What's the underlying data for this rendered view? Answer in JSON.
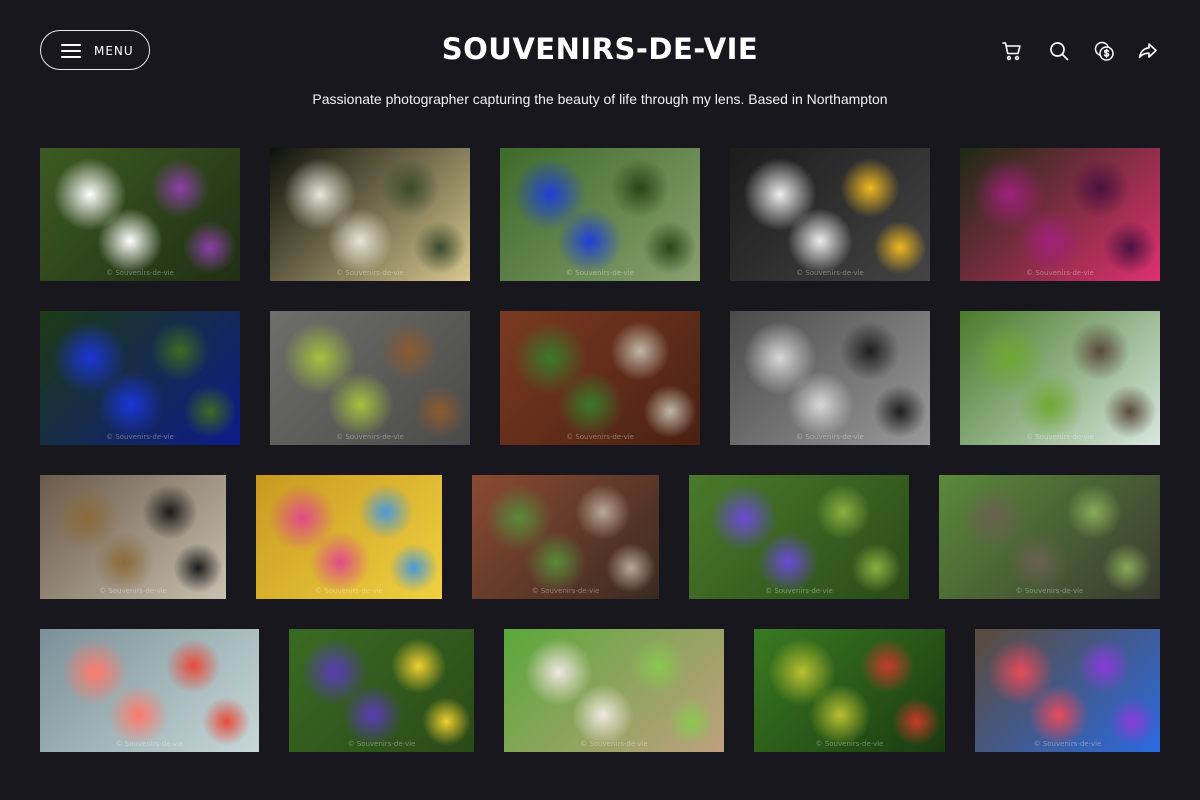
{
  "header": {
    "menu_label": "MENU",
    "title": "SOUVENIRS-DE-VIE",
    "tagline": "Passionate photographer capturing the beauty of life through my lens. Based in Northampton",
    "icons": [
      "cart-icon",
      "search-icon",
      "currency-icon",
      "share-icon"
    ]
  },
  "gallery": {
    "watermark": "© Souvenirs-de-vie",
    "photos": [
      {
        "name": "photo-white-purple-wildflowers",
        "colors": [
          "#3d5a22",
          "#ffffff",
          "#8b3fa6",
          "#1f2f14"
        ]
      },
      {
        "name": "photo-white-blossoms-dark",
        "colors": [
          "#0e120b",
          "#e8e6da",
          "#3a4a2a",
          "#d8c890"
        ]
      },
      {
        "name": "photo-blue-cornflowers-field",
        "colors": [
          "#3c6a2a",
          "#1f3fd6",
          "#2a4518",
          "#8aa070"
        ]
      },
      {
        "name": "photo-white-peony",
        "colors": [
          "#1c1c1c",
          "#eeeeee",
          "#f0b820",
          "#444444"
        ]
      },
      {
        "name": "photo-magenta-sweet-peas",
        "colors": [
          "#1d2a14",
          "#a0207a",
          "#4a1240",
          "#e03070"
        ]
      },
      {
        "name": "photo-blue-cornflowers-close",
        "colors": [
          "#1d3a14",
          "#1a35d8",
          "#3b6a22",
          "#0d1b8a"
        ]
      },
      {
        "name": "photo-leaves-on-cobblestones",
        "colors": [
          "#6e6e6a",
          "#a8c040",
          "#8c5a30",
          "#4a4a48"
        ]
      },
      {
        "name": "photo-bicycle-storefront",
        "colors": [
          "#7a3a22",
          "#3a7a2a",
          "#c0b8a8",
          "#4a2012"
        ]
      },
      {
        "name": "photo-bw-gears",
        "colors": [
          "#4a4a4a",
          "#d8d8d8",
          "#1e1e1e",
          "#9a9a9a"
        ]
      },
      {
        "name": "photo-thatched-cottage-garden",
        "colors": [
          "#4a7a2a",
          "#6ea832",
          "#5a4a3a",
          "#d8e8e0"
        ]
      },
      {
        "name": "photo-wine-basket",
        "colors": [
          "#6a5a4a",
          "#8a6a3a",
          "#1a1a1a",
          "#c8c0b0"
        ]
      },
      {
        "name": "photo-pinwheels",
        "colors": [
          "#c89a20",
          "#e04a8a",
          "#4a9ad8",
          "#f0d040"
        ]
      },
      {
        "name": "photo-street-corner-cafe",
        "colors": [
          "#8a4a32",
          "#5a8a3a",
          "#b8a898",
          "#3a2a22"
        ]
      },
      {
        "name": "photo-grape-hyacinths",
        "colors": [
          "#4a7a2a",
          "#6a4ad8",
          "#8ab040",
          "#2a4a18"
        ]
      },
      {
        "name": "photo-otters-on-grass",
        "colors": [
          "#5a8a3a",
          "#6a6050",
          "#8aaa5a",
          "#3a3a30"
        ]
      },
      {
        "name": "photo-flamingo-splash",
        "colors": [
          "#7a9098",
          "#ff7a6a",
          "#e84a3a",
          "#c8d8d8"
        ]
      },
      {
        "name": "photo-purple-iris",
        "colors": [
          "#3a6a22",
          "#5a3ab8",
          "#f0d030",
          "#2a4a18"
        ]
      },
      {
        "name": "photo-white-finches-branch",
        "colors": [
          "#5aa83a",
          "#f0e8e0",
          "#8ac850",
          "#c0a080"
        ]
      },
      {
        "name": "photo-gooseberries",
        "colors": [
          "#3a7a22",
          "#b8c030",
          "#c83a2a",
          "#1a3a10"
        ]
      },
      {
        "name": "photo-butterflies-watermelon",
        "colors": [
          "#5a4a3a",
          "#e84a5a",
          "#8a3ad8",
          "#2a6ae0"
        ]
      }
    ]
  }
}
